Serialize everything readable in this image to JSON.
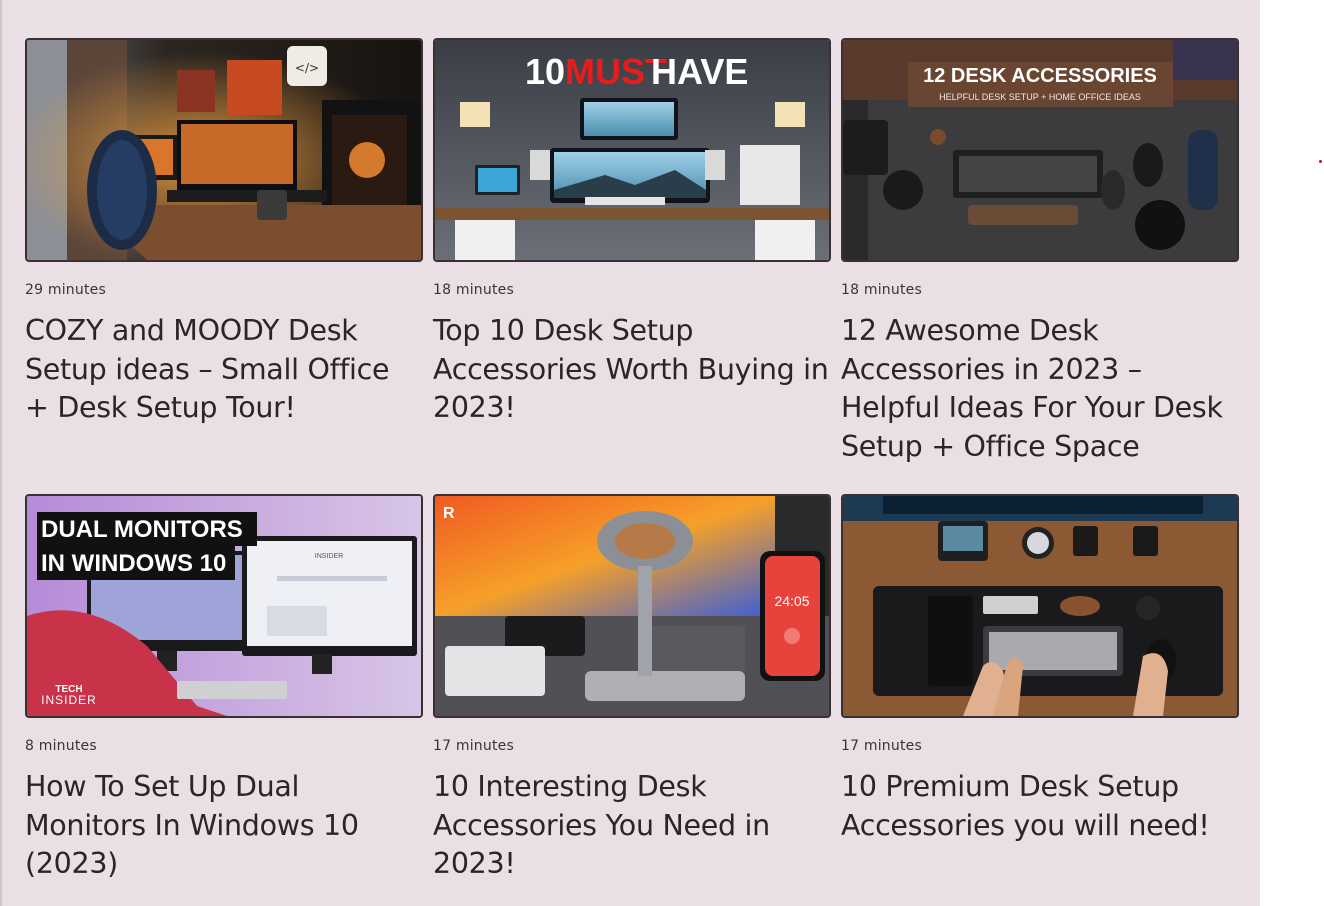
{
  "videos": [
    {
      "duration": "29 minutes",
      "title": "COZY and MOODY Desk Setup ideas – Small Office + Desk Setup Tour!"
    },
    {
      "duration": "18 minutes",
      "title": "Top 10 Desk Setup Accessories Worth Buying in 2023!",
      "overlay": {
        "num": "10",
        "must": "MUST",
        "have": "HAVE"
      }
    },
    {
      "duration": "18 minutes",
      "title": "12 Awesome Desk Accessories in 2023 – Helpful Ideas For Your Desk Setup + Office Space",
      "overlay": {
        "line1": "12 DESK ACCESSORIES",
        "line2": "HELPFUL DESK SETUP + HOME OFFICE IDEAS"
      }
    },
    {
      "duration": "8 minutes",
      "title": "How To Set Up Dual Monitors In Windows 10 (2023)",
      "overlay": {
        "line1": "DUAL MONITORS",
        "line2": "IN WINDOWS 10",
        "logo1": "TECH",
        "logo2": "INSIDER",
        "screen_header": "INSIDER"
      }
    },
    {
      "duration": "17 minutes",
      "title": "10 Interesting Desk Accessories You Need in 2023!",
      "overlay": {
        "clock": "24:05"
      }
    },
    {
      "duration": "17 minutes",
      "title": "10 Premium Desk Setup Accessories you will need!"
    }
  ]
}
